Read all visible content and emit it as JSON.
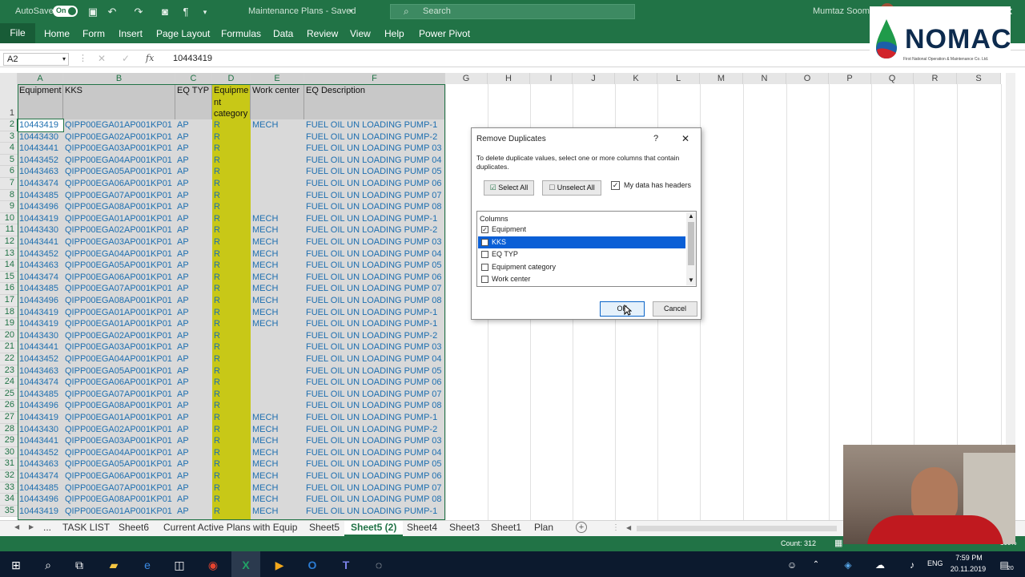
{
  "titlebar": {
    "autosave_label": "AutoSave",
    "autosave_state": "On",
    "doc_title": "Maintenance Plans - Saved",
    "search_placeholder": "Search",
    "user_name": "Mumtaz Soomro"
  },
  "ribbon": {
    "file": "File",
    "tabs": [
      "Home",
      "Form",
      "Insert",
      "Page Layout",
      "Formulas",
      "Data",
      "Review",
      "View",
      "Help",
      "Power Pivot"
    ]
  },
  "logo": {
    "text": "NOMAC",
    "tagline": "First National Operation & Maintenance Co. Ltd."
  },
  "formula_bar": {
    "name_box": "A2",
    "fx": "fx",
    "value": "10443419"
  },
  "columns": [
    "A",
    "B",
    "C",
    "D",
    "E",
    "F",
    "G",
    "H",
    "I",
    "J",
    "K",
    "L",
    "M",
    "N",
    "O",
    "P",
    "Q",
    "R",
    "S"
  ],
  "header_row": {
    "row": "1",
    "a": "Equipment",
    "b": "KKS",
    "c": "EQ TYP",
    "d": "Equipme nt category",
    "e": "Work center",
    "f": "EQ  Description"
  },
  "rows": [
    {
      "n": "2",
      "a": "10443419",
      "b": "QIPP00EGA01AP001KP01",
      "c": "AP",
      "d": "R",
      "e": "MECH",
      "f": "FUEL OIL UN LOADING PUMP-1"
    },
    {
      "n": "3",
      "a": "10443430",
      "b": "QIPP00EGA02AP001KP01",
      "c": "AP",
      "d": "R",
      "e": "",
      "f": "FUEL OIL UN LOADING PUMP-2"
    },
    {
      "n": "4",
      "a": "10443441",
      "b": "QIPP00EGA03AP001KP01",
      "c": "AP",
      "d": "R",
      "e": "",
      "f": "FUEL OIL UN LOADING PUMP 03"
    },
    {
      "n": "5",
      "a": "10443452",
      "b": "QIPP00EGA04AP001KP01",
      "c": "AP",
      "d": "R",
      "e": "",
      "f": "FUEL OIL UN LOADING PUMP 04"
    },
    {
      "n": "6",
      "a": "10443463",
      "b": "QIPP00EGA05AP001KP01",
      "c": "AP",
      "d": "R",
      "e": "",
      "f": "FUEL OIL UN LOADING PUMP 05"
    },
    {
      "n": "7",
      "a": "10443474",
      "b": "QIPP00EGA06AP001KP01",
      "c": "AP",
      "d": "R",
      "e": "",
      "f": "FUEL OIL UN LOADING PUMP 06"
    },
    {
      "n": "8",
      "a": "10443485",
      "b": "QIPP00EGA07AP001KP01",
      "c": "AP",
      "d": "R",
      "e": "",
      "f": "FUEL OIL UN LOADING PUMP 07"
    },
    {
      "n": "9",
      "a": "10443496",
      "b": "QIPP00EGA08AP001KP01",
      "c": "AP",
      "d": "R",
      "e": "",
      "f": "FUEL OIL UN LOADING PUMP 08"
    },
    {
      "n": "10",
      "a": "10443419",
      "b": "QIPP00EGA01AP001KP01",
      "c": "AP",
      "d": "R",
      "e": "MECH",
      "f": "FUEL OIL UN LOADING PUMP-1"
    },
    {
      "n": "11",
      "a": "10443430",
      "b": "QIPP00EGA02AP001KP01",
      "c": "AP",
      "d": "R",
      "e": "MECH",
      "f": "FUEL OIL UN LOADING PUMP-2"
    },
    {
      "n": "12",
      "a": "10443441",
      "b": "QIPP00EGA03AP001KP01",
      "c": "AP",
      "d": "R",
      "e": "MECH",
      "f": "FUEL OIL UN LOADING PUMP 03"
    },
    {
      "n": "13",
      "a": "10443452",
      "b": "QIPP00EGA04AP001KP01",
      "c": "AP",
      "d": "R",
      "e": "MECH",
      "f": "FUEL OIL UN LOADING PUMP 04"
    },
    {
      "n": "14",
      "a": "10443463",
      "b": "QIPP00EGA05AP001KP01",
      "c": "AP",
      "d": "R",
      "e": "MECH",
      "f": "FUEL OIL UN LOADING PUMP 05"
    },
    {
      "n": "15",
      "a": "10443474",
      "b": "QIPP00EGA06AP001KP01",
      "c": "AP",
      "d": "R",
      "e": "MECH",
      "f": "FUEL OIL UN LOADING PUMP 06"
    },
    {
      "n": "16",
      "a": "10443485",
      "b": "QIPP00EGA07AP001KP01",
      "c": "AP",
      "d": "R",
      "e": "MECH",
      "f": "FUEL OIL UN LOADING PUMP 07"
    },
    {
      "n": "17",
      "a": "10443496",
      "b": "QIPP00EGA08AP001KP01",
      "c": "AP",
      "d": "R",
      "e": "MECH",
      "f": "FUEL OIL UN LOADING PUMP 08"
    },
    {
      "n": "18",
      "a": "10443419",
      "b": "QIPP00EGA01AP001KP01",
      "c": "AP",
      "d": "R",
      "e": "MECH",
      "f": "FUEL OIL UN LOADING PUMP-1"
    },
    {
      "n": "19",
      "a": "10443419",
      "b": "QIPP00EGA01AP001KP01",
      "c": "AP",
      "d": "R",
      "e": "MECH",
      "f": "FUEL OIL UN LOADING PUMP-1"
    },
    {
      "n": "20",
      "a": "10443430",
      "b": "QIPP00EGA02AP001KP01",
      "c": "AP",
      "d": "R",
      "e": "",
      "f": "FUEL OIL UN LOADING PUMP-2"
    },
    {
      "n": "21",
      "a": "10443441",
      "b": "QIPP00EGA03AP001KP01",
      "c": "AP",
      "d": "R",
      "e": "",
      "f": "FUEL OIL UN LOADING PUMP 03"
    },
    {
      "n": "22",
      "a": "10443452",
      "b": "QIPP00EGA04AP001KP01",
      "c": "AP",
      "d": "R",
      "e": "",
      "f": "FUEL OIL UN LOADING PUMP 04"
    },
    {
      "n": "23",
      "a": "10443463",
      "b": "QIPP00EGA05AP001KP01",
      "c": "AP",
      "d": "R",
      "e": "",
      "f": "FUEL OIL UN LOADING PUMP 05"
    },
    {
      "n": "24",
      "a": "10443474",
      "b": "QIPP00EGA06AP001KP01",
      "c": "AP",
      "d": "R",
      "e": "",
      "f": "FUEL OIL UN LOADING PUMP 06"
    },
    {
      "n": "25",
      "a": "10443485",
      "b": "QIPP00EGA07AP001KP01",
      "c": "AP",
      "d": "R",
      "e": "",
      "f": "FUEL OIL UN LOADING PUMP 07"
    },
    {
      "n": "26",
      "a": "10443496",
      "b": "QIPP00EGA08AP001KP01",
      "c": "AP",
      "d": "R",
      "e": "",
      "f": "FUEL OIL UN LOADING PUMP 08"
    },
    {
      "n": "27",
      "a": "10443419",
      "b": "QIPP00EGA01AP001KP01",
      "c": "AP",
      "d": "R",
      "e": "MECH",
      "f": "FUEL OIL UN LOADING PUMP-1"
    },
    {
      "n": "28",
      "a": "10443430",
      "b": "QIPP00EGA02AP001KP01",
      "c": "AP",
      "d": "R",
      "e": "MECH",
      "f": "FUEL OIL UN LOADING PUMP-2"
    },
    {
      "n": "29",
      "a": "10443441",
      "b": "QIPP00EGA03AP001KP01",
      "c": "AP",
      "d": "R",
      "e": "MECH",
      "f": "FUEL OIL UN LOADING PUMP 03"
    },
    {
      "n": "30",
      "a": "10443452",
      "b": "QIPP00EGA04AP001KP01",
      "c": "AP",
      "d": "R",
      "e": "MECH",
      "f": "FUEL OIL UN LOADING PUMP 04"
    },
    {
      "n": "31",
      "a": "10443463",
      "b": "QIPP00EGA05AP001KP01",
      "c": "AP",
      "d": "R",
      "e": "MECH",
      "f": "FUEL OIL UN LOADING PUMP 05"
    },
    {
      "n": "32",
      "a": "10443474",
      "b": "QIPP00EGA06AP001KP01",
      "c": "AP",
      "d": "R",
      "e": "MECH",
      "f": "FUEL OIL UN LOADING PUMP 06"
    },
    {
      "n": "33",
      "a": "10443485",
      "b": "QIPP00EGA07AP001KP01",
      "c": "AP",
      "d": "R",
      "e": "MECH",
      "f": "FUEL OIL UN LOADING PUMP 07"
    },
    {
      "n": "34",
      "a": "10443496",
      "b": "QIPP00EGA08AP001KP01",
      "c": "AP",
      "d": "R",
      "e": "MECH",
      "f": "FUEL OIL UN LOADING PUMP 08"
    },
    {
      "n": "35",
      "a": "10443419",
      "b": "QIPP00EGA01AP001KP01",
      "c": "AP",
      "d": "R",
      "e": "MECH",
      "f": "FUEL OIL UN LOADING PUMP-1"
    }
  ],
  "dialog": {
    "title": "Remove Duplicates",
    "help": "?",
    "instructions": "To delete duplicate values, select one or more columns that contain duplicates.",
    "select_all": "Select All",
    "unselect_all": "Unselect All",
    "my_data_has_headers": "My data has headers",
    "headers_checked": true,
    "columns_label": "Columns",
    "columns": [
      {
        "label": "Equipment",
        "checked": true,
        "selected": false
      },
      {
        "label": "KKS",
        "checked": false,
        "selected": true
      },
      {
        "label": "EQ TYP",
        "checked": false,
        "selected": false
      },
      {
        "label": "Equipment category",
        "checked": false,
        "selected": false
      },
      {
        "label": "Work center",
        "checked": false,
        "selected": false
      }
    ],
    "ok": "OK",
    "cancel": "Cancel"
  },
  "sheet_tabs": {
    "ellipsis": "...",
    "tabs": [
      "TASK LIST",
      "Sheet6",
      "Current Active Plans with Equip",
      "Sheet5",
      "Sheet5 (2)",
      "Sheet4",
      "Sheet3",
      "Sheet1",
      "Plan"
    ],
    "active": "Sheet5 (2)"
  },
  "status": {
    "count": "Count: 312",
    "zoom": "100%"
  },
  "taskbar": {
    "lang": "ENG",
    "time": "7:59 PM",
    "date": "20.11.2019",
    "notifications": "20"
  },
  "colors": {
    "excel_green": "#217346",
    "cell_text": "#1e6fb0",
    "category_yellow": "#c8c817",
    "selection_blue": "#0a5fd6"
  }
}
